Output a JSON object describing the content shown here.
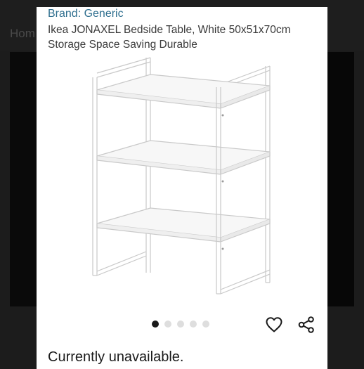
{
  "background": {
    "breadcrumb_fragment": "Hom"
  },
  "product": {
    "brand": "Brand: Generic",
    "title": "Ikea JONAXEL Bedside Table, White 50x51x70cm Storage Space Saving Durable",
    "image_alt": "White metal bedside table with three shelves",
    "availability": "Currently unavailable."
  },
  "gallery": {
    "image_count": 5,
    "active_index": 0
  },
  "actions": {
    "favorite_icon": "heart-icon",
    "share_icon": "share-icon"
  },
  "colors": {
    "brand_link": "#2f6f8f",
    "dot_active": "#1a1a1a",
    "dot_inactive": "#dedede"
  }
}
